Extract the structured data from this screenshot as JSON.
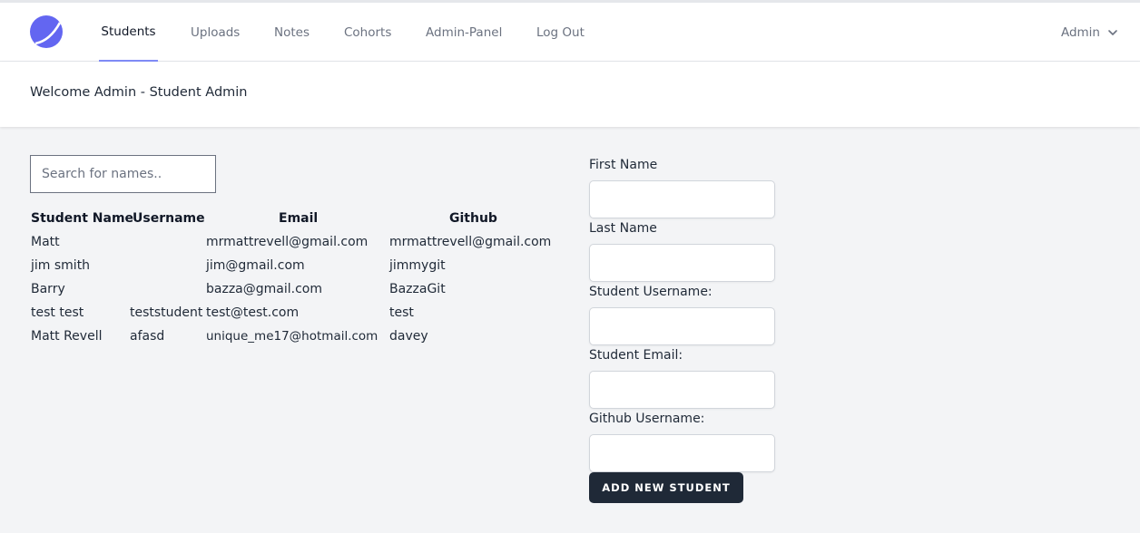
{
  "nav": {
    "links": [
      {
        "label": "Students",
        "active": true
      },
      {
        "label": "Uploads",
        "active": false
      },
      {
        "label": "Notes",
        "active": false
      },
      {
        "label": "Cohorts",
        "active": false
      },
      {
        "label": "Admin-Panel",
        "active": false
      },
      {
        "label": "Log Out",
        "active": false
      }
    ],
    "user_label": "Admin",
    "accent_color": "#818cf8",
    "logo_color": "#6366f1"
  },
  "page": {
    "title": "Welcome Admin - Student Admin"
  },
  "search": {
    "placeholder": "Search for names.."
  },
  "table": {
    "headers": [
      "Student Name",
      "Username",
      "Email",
      "Github"
    ],
    "rows": [
      [
        "Matt",
        "",
        "mrmattrevell@gmail.com",
        "mrmattrevell@gmail.com"
      ],
      [
        "jim smith",
        "",
        "jim@gmail.com",
        "jimmygit"
      ],
      [
        "Barry",
        "",
        "bazza@gmail.com",
        "BazzaGit"
      ],
      [
        "test test",
        "teststudent",
        "test@test.com",
        "test"
      ],
      [
        "Matt Revell",
        "afasd",
        "unique_me17@hotmail.com",
        "davey"
      ]
    ]
  },
  "form": {
    "labels": [
      "First Name",
      "Last Name",
      "Student Username:",
      "Student Email:",
      "Github Username:"
    ],
    "submit_label": "ADD NEW STUDENT"
  }
}
